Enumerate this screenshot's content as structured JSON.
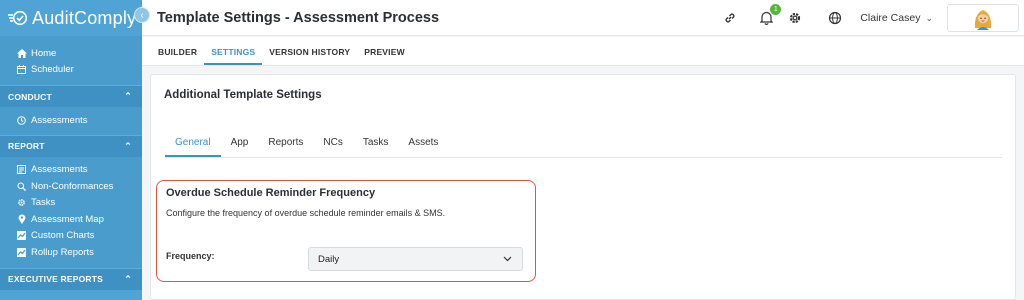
{
  "brand": {
    "name": "AuditComply"
  },
  "sidebar": {
    "top_items": [
      {
        "label": "Home",
        "icon": "home-icon"
      },
      {
        "label": "Scheduler",
        "icon": "calendar-icon"
      }
    ],
    "sections": [
      {
        "title": "CONDUCT",
        "items": [
          {
            "label": "Assessments",
            "icon": "clock-icon"
          }
        ]
      },
      {
        "title": "REPORT",
        "items": [
          {
            "label": "Assessments",
            "icon": "list-icon"
          },
          {
            "label": "Non-Conformances",
            "icon": "search-icon"
          },
          {
            "label": "Tasks",
            "icon": "gear-icon"
          },
          {
            "label": "Assessment Map",
            "icon": "pin-icon"
          },
          {
            "label": "Custom Charts",
            "icon": "chart-icon"
          },
          {
            "label": "Rollup Reports",
            "icon": "chart-icon"
          }
        ]
      },
      {
        "title": "EXECUTIVE REPORTS",
        "items": []
      }
    ]
  },
  "header": {
    "title": "Template Settings - Assessment Process",
    "notification_count": "1",
    "user_name": "Claire Casey"
  },
  "tabs": [
    "BUILDER",
    "SETTINGS",
    "VERSION HISTORY",
    "PREVIEW"
  ],
  "active_tab": "SETTINGS",
  "card": {
    "title": "Additional Template Settings",
    "subtabs": [
      "General",
      "App",
      "Reports",
      "NCs",
      "Tasks",
      "Assets"
    ],
    "active_subtab": "General",
    "reminder": {
      "title": "Overdue Schedule Reminder Frequency",
      "description": "Configure the frequency of overdue schedule reminder emails & SMS.",
      "frequency_label": "Frequency:",
      "frequency_value": "Daily"
    }
  },
  "colors": {
    "sidebar": "#4fa3d5",
    "accent": "#3a93c6",
    "highlight": "#e0573e",
    "badge": "#58b53a"
  }
}
